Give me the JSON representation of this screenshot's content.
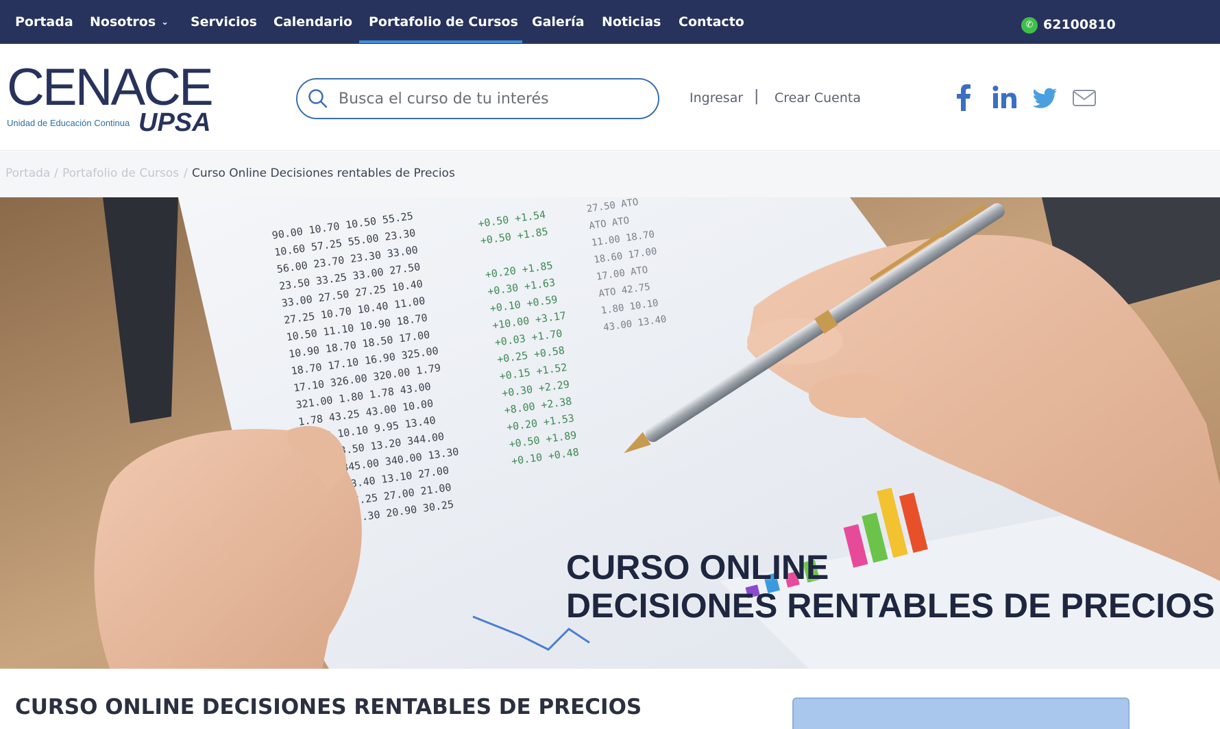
{
  "nav": {
    "items": [
      {
        "label": "Portada"
      },
      {
        "label": "Nosotros"
      },
      {
        "label": "Servicios"
      },
      {
        "label": "Calendario"
      },
      {
        "label": "Portafolio de Cursos"
      },
      {
        "label": "Galería"
      },
      {
        "label": "Noticias"
      },
      {
        "label": "Contacto"
      }
    ],
    "active": "Portafolio de Cursos",
    "phone": "62100810"
  },
  "header": {
    "logo_main": "CENACE",
    "logo_sub": "Unidad de Educación Continua",
    "logo_upsa": "UPSA",
    "search_placeholder": "Busca el curso de tu interés",
    "login": "Ingresar",
    "separator": "|",
    "register": "Crear Cuenta",
    "social": [
      "facebook-icon",
      "linkedin-icon",
      "twitter-icon",
      "mail-icon"
    ]
  },
  "breadcrumb": {
    "items": [
      "Portada",
      "Portafolio de Cursos",
      "Curso Online Decisiones rentables de Precios"
    ],
    "separator": "/"
  },
  "hero": {
    "line1": "CURSO ONLINE",
    "line2": "DECISIONES RENTABLES DE PRECIOS"
  },
  "page": {
    "title": "CURSO ONLINE DECISIONES RENTABLES DE PRECIOS"
  },
  "colors": {
    "nav_bg": "#27335c",
    "nav_active": "#3f8fe0",
    "brand": "#27335c",
    "whatsapp": "#3fbf4a",
    "side_card": "#a9c6ec"
  }
}
